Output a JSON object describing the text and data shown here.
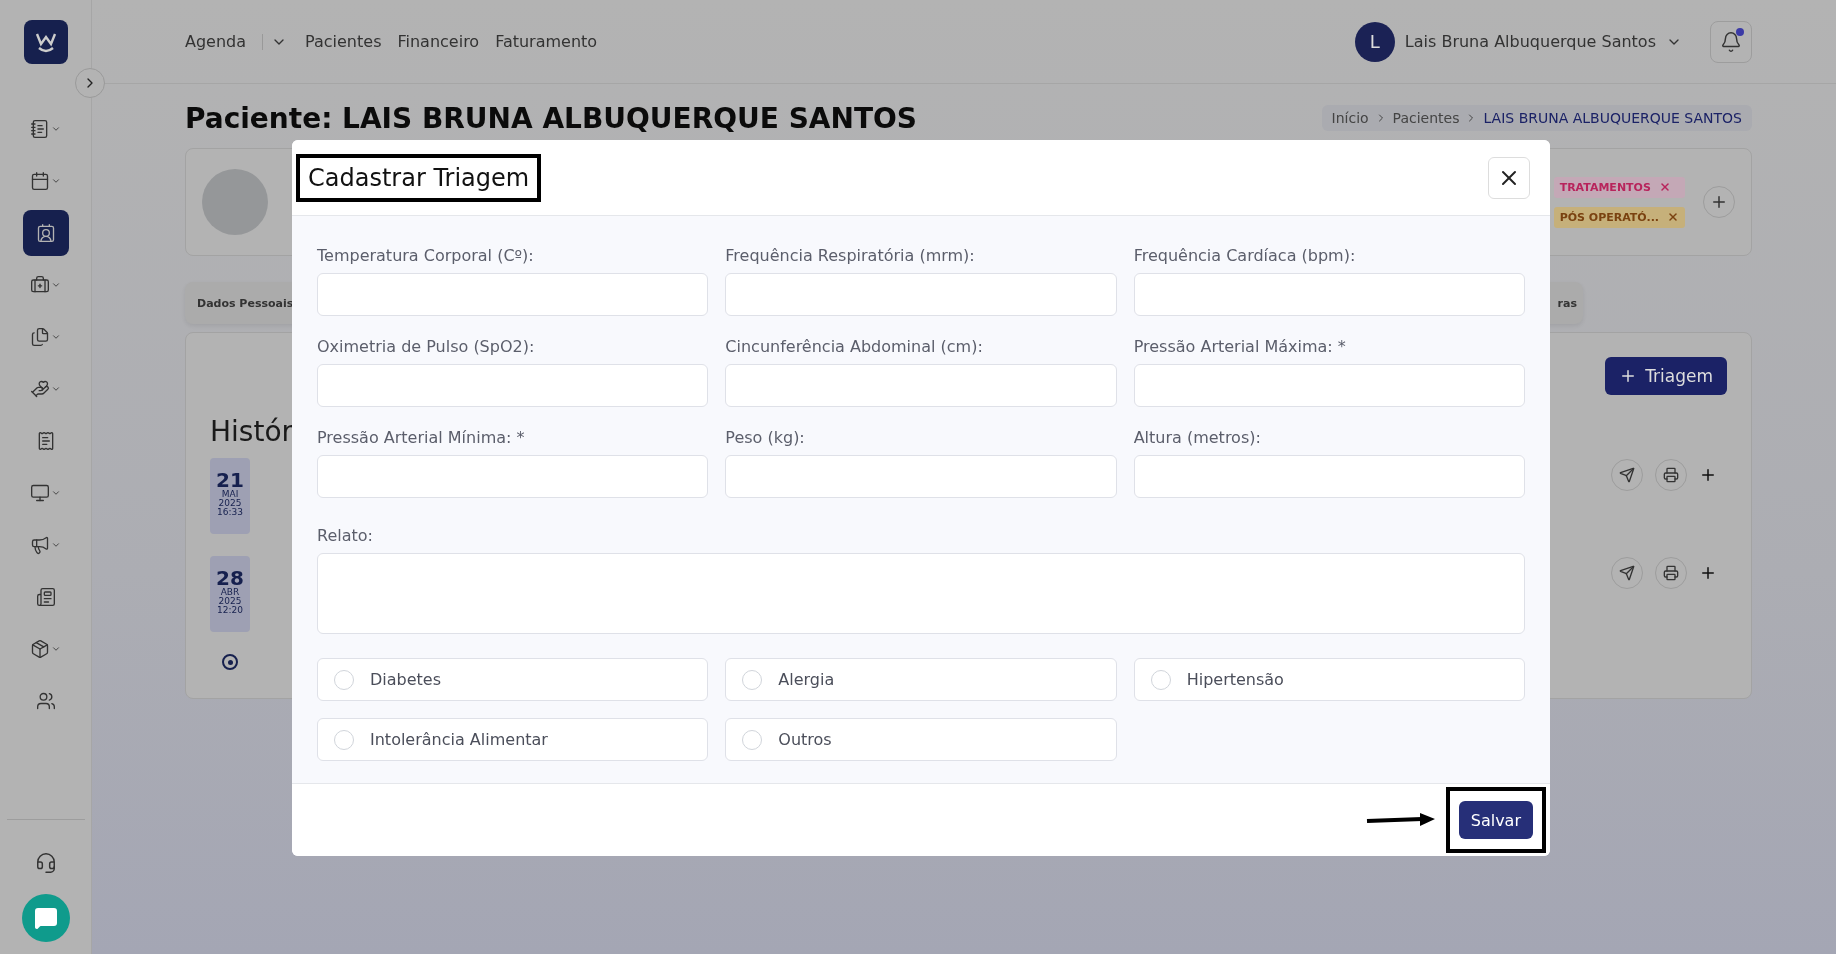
{
  "sidebar": {
    "items": [
      {
        "selected": false,
        "has_menu": true
      },
      {
        "selected": false,
        "has_menu": true
      },
      {
        "selected": true,
        "has_menu": false
      },
      {
        "selected": false,
        "has_menu": true
      },
      {
        "selected": false,
        "has_menu": true
      },
      {
        "selected": false,
        "has_menu": true
      },
      {
        "selected": false,
        "has_menu": false
      },
      {
        "selected": false,
        "has_menu": true
      },
      {
        "selected": false,
        "has_menu": true
      },
      {
        "selected": false,
        "has_menu": false
      },
      {
        "selected": false,
        "has_menu": true
      },
      {
        "selected": false,
        "has_menu": false
      }
    ]
  },
  "header": {
    "nav": [
      {
        "label": "Agenda",
        "has_menu": true
      },
      {
        "label": "Pacientes",
        "has_menu": false
      },
      {
        "label": "Financeiro",
        "has_menu": false
      },
      {
        "label": "Faturamento",
        "has_menu": false
      }
    ],
    "user": {
      "initial": "L",
      "name": "Lais Bruna Albuquerque Santos"
    },
    "notifications_unread": true
  },
  "page": {
    "title": "Paciente: LAIS BRUNA ALBUQUERQUE SANTOS",
    "breadcrumb": [
      "Início",
      "Pacientes",
      "LAIS BRUNA ALBUQUERQUE SANTOS"
    ],
    "tags": [
      {
        "label": "TRATAMENTOS",
        "color": "#b8245c"
      },
      {
        "label": "PÓS OPERATÓ...",
        "color": "#7a4210"
      }
    ],
    "tabs": [
      "Dados Pessoais",
      "ras"
    ],
    "history_title": "Histór",
    "add_button": "Triagem",
    "timeline": [
      {
        "day": "21",
        "month": "MAI",
        "year": "2025",
        "time": "16:33"
      },
      {
        "day": "28",
        "month": "ABR",
        "year": "2025",
        "time": "12:20"
      }
    ]
  },
  "modal": {
    "title": "Cadastrar Triagem",
    "fields": [
      {
        "label": "Temperatura Corporal (Cº):"
      },
      {
        "label": "Frequência Respiratória (mrm):"
      },
      {
        "label": "Frequência Cardíaca (bpm):"
      },
      {
        "label": "Oximetria de Pulso (SpO2):"
      },
      {
        "label": "Cincunferência Abdominal (cm):"
      },
      {
        "label": "Pressão Arterial Máxima: *"
      },
      {
        "label": "Pressão Arterial Mínima: *"
      },
      {
        "label": "Peso (kg):"
      },
      {
        "label": "Altura (metros):"
      }
    ],
    "report_label": "Relato:",
    "conditions": [
      {
        "label": "Diabetes",
        "checked": false
      },
      {
        "label": "Alergia",
        "checked": false
      },
      {
        "label": "Hipertensão",
        "checked": false
      },
      {
        "label": "Intolerância Alimentar",
        "checked": false
      },
      {
        "label": "Outros",
        "checked": false
      }
    ],
    "save_button": "Salvar"
  }
}
